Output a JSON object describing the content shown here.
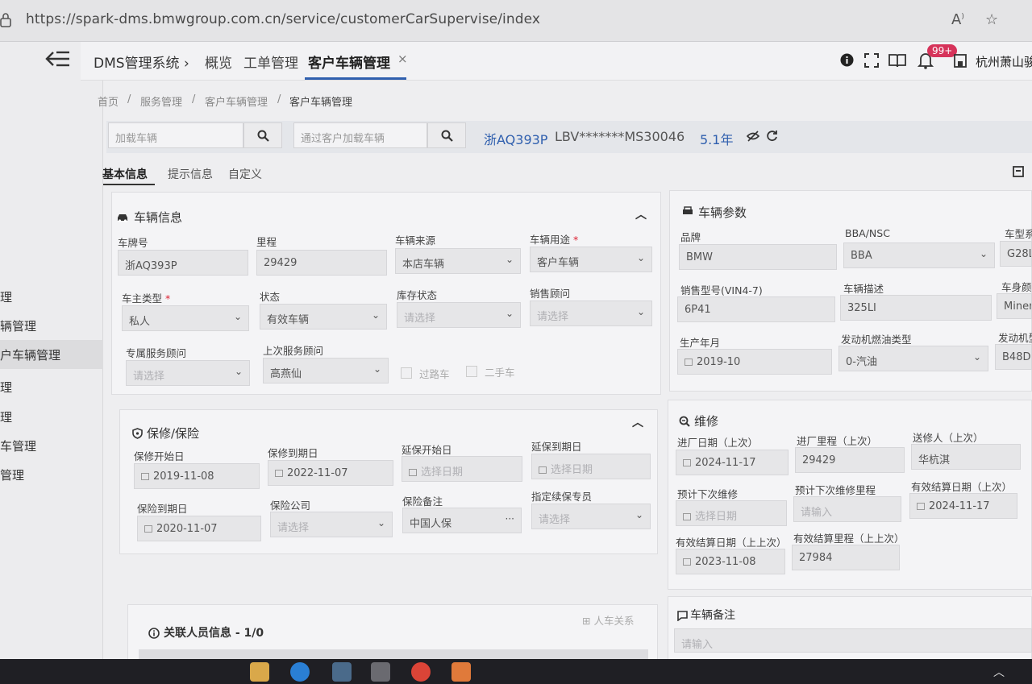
{
  "browser": {
    "url": "https://spark-dms.bmwgroup.com.cn/service/customerCarSupervise/index"
  },
  "sidebar": {
    "items": [
      {
        "label": "理",
        "active": false
      },
      {
        "label": "辆管理",
        "active": false
      },
      {
        "label": "户车辆管理",
        "active": true
      },
      {
        "label": "理",
        "active": false
      },
      {
        "label": "理",
        "active": false
      },
      {
        "label": "车管理",
        "active": false
      },
      {
        "label": "管理",
        "active": false
      }
    ]
  },
  "header": {
    "brand": "DMS管理系统 ›",
    "tabs": [
      {
        "label": "概览",
        "active": false
      },
      {
        "label": "工单管理",
        "active": false
      },
      {
        "label": "客户车辆管理",
        "active": true
      }
    ],
    "tab_close": "×",
    "badge": "99+",
    "user": "杭州萧山骏"
  },
  "breadcrumb": [
    "首页",
    "服务管理",
    "客户车辆管理",
    "客户车辆管理"
  ],
  "search": {
    "vehicle_placeholder": "加载车辆",
    "customer_placeholder": "通过客户加载车辆",
    "plate": "浙AQ393P",
    "vin": "LBV*******MS30046",
    "age": "5.1年"
  },
  "subtabs": [
    "基本信息",
    "提示信息",
    "自定义"
  ],
  "vehicle_info": {
    "title": "车辆信息",
    "fields": [
      {
        "label": "车牌号",
        "value": "浙AQ393P"
      },
      {
        "label": "里程",
        "value": "29429"
      },
      {
        "label": "车辆来源",
        "value": "本店车辆"
      },
      {
        "label": "车辆用途",
        "value": "客户车辆"
      },
      {
        "label": "车主类型",
        "value": "私人"
      },
      {
        "label": "状态",
        "value": "有效车辆"
      },
      {
        "label": "库存状态",
        "value": "请选择"
      },
      {
        "label": "销售顾问",
        "value": "请选择"
      },
      {
        "label": "专属服务顾问",
        "value": "请选择"
      },
      {
        "label": "上次服务顾问",
        "value": "高燕仙"
      }
    ],
    "checkbox_passing": "过路车",
    "checkbox_used": "二手车"
  },
  "warranty": {
    "title": "保修/保险",
    "fields": [
      {
        "label": "保修开始日",
        "value": "2019-11-08"
      },
      {
        "label": "保修到期日",
        "value": "2022-11-07"
      },
      {
        "label": "延保开始日",
        "value": "选择日期"
      },
      {
        "label": "延保到期日",
        "value": "选择日期"
      },
      {
        "label": "保险到期日",
        "value": "2020-11-07"
      },
      {
        "label": "保险公司",
        "value": "请选择"
      },
      {
        "label": "保险备注",
        "value": "中国人保"
      },
      {
        "label": "指定续保专员",
        "value": "请选择"
      }
    ],
    "more": "···"
  },
  "params": {
    "title": "车辆参数",
    "fields": [
      {
        "label": "品牌",
        "value": "BMW"
      },
      {
        "label": "BBA/NSC",
        "value": "BBA"
      },
      {
        "label": "车型系",
        "value": "G28L"
      },
      {
        "label": "销售型号(VIN4-7)",
        "value": "6P41"
      },
      {
        "label": "车辆描述",
        "value": "325LI"
      },
      {
        "label": "车身颜",
        "value": "Minera"
      },
      {
        "label": "生产年月",
        "value": "2019-10"
      },
      {
        "label": "发动机燃油类型",
        "value": "0-汽油"
      },
      {
        "label": "发动机型",
        "value": "B48D"
      }
    ]
  },
  "repair": {
    "title": "维修",
    "fields": [
      {
        "label": "进厂日期（上次）",
        "value": "2024-11-17"
      },
      {
        "label": "进厂里程（上次）",
        "value": "29429"
      },
      {
        "label": "送修人（上次）",
        "value": "华杭淇"
      },
      {
        "label": "预计下次维修",
        "value": "选择日期"
      },
      {
        "label": "预计下次维修里程",
        "value": "请输入"
      },
      {
        "label": "有效结算日期（上次）",
        "value": "2024-11-17"
      },
      {
        "label": "有效结算日期（上上次）",
        "value": "2023-11-08"
      },
      {
        "label": "有效结算里程（上上次）",
        "value": "27984"
      }
    ]
  },
  "related": {
    "title": "关联人员信息 - 1/0",
    "action": "人车关系"
  },
  "remark": {
    "title": "车辆备注",
    "placeholder": "请输入"
  }
}
